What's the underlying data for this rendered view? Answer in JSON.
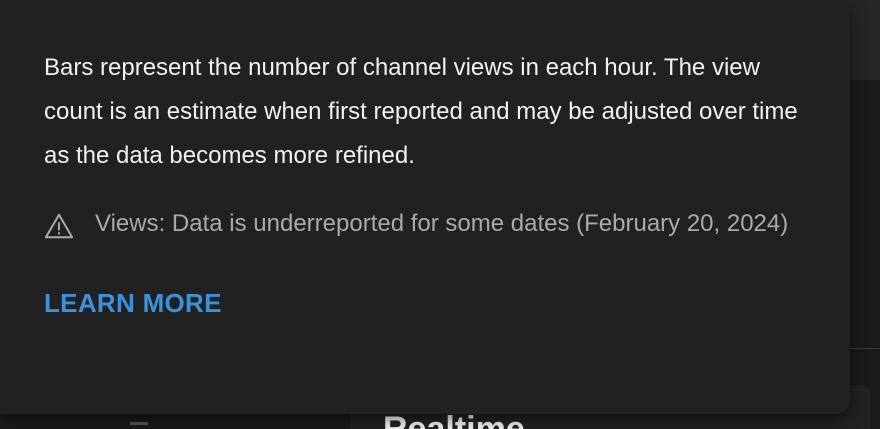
{
  "tooltip": {
    "description": "Bars represent the number of channel views in each hour. The view count is an estimate when first reported and may be adjusted over time as the data becomes more refined.",
    "warning": {
      "icon": "warning-triangle-icon",
      "text": "Views: Data is underreported for some dates (February 20, 2024)"
    },
    "learn_more_label": "LEARN MORE"
  },
  "background": {
    "heading_fragment": "Realtime"
  },
  "colors": {
    "tooltip_bg": "#212121",
    "text_primary": "#f1f1f1",
    "text_secondary": "#aaaaaa",
    "link": "#3ea6ff"
  }
}
